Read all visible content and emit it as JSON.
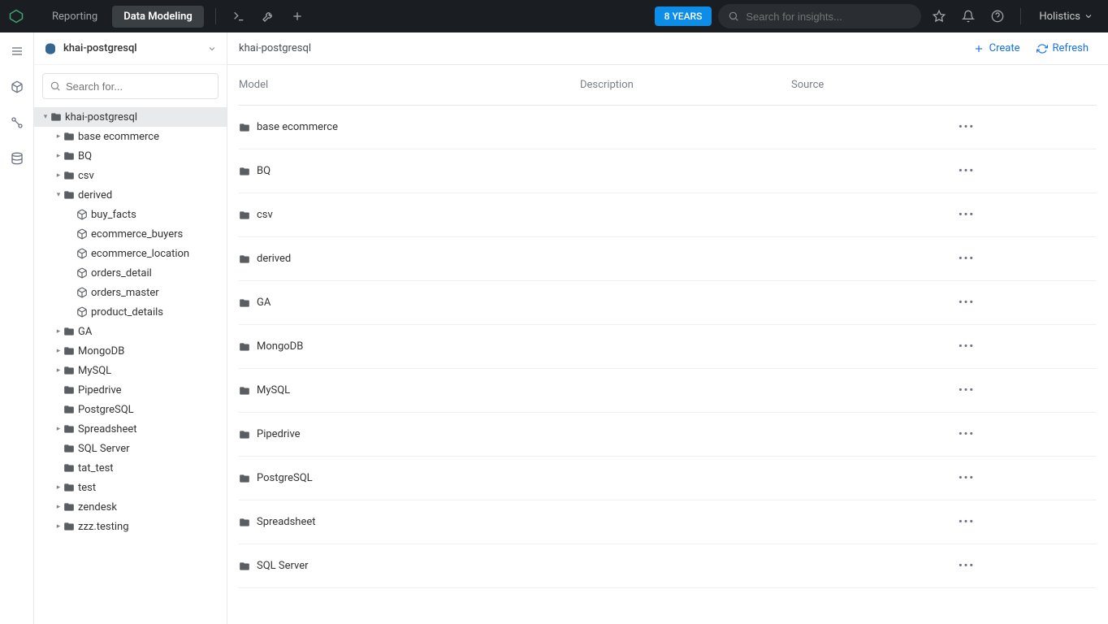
{
  "topbar": {
    "nav": {
      "reporting": "Reporting",
      "data_modeling": "Data Modeling"
    },
    "badge": "8 YEARS",
    "search_placeholder": "Search for insights...",
    "account_name": "Holistics"
  },
  "sidebar": {
    "source_name": "khai-postgresql",
    "search_placeholder": "Search for...",
    "tree": {
      "root": {
        "label": "khai-postgresql",
        "expanded": true
      },
      "folders": [
        {
          "label": "base ecommerce",
          "caret": true,
          "expanded": false
        },
        {
          "label": "BQ",
          "caret": true,
          "expanded": false
        },
        {
          "label": "csv",
          "caret": true,
          "expanded": false
        },
        {
          "label": "derived",
          "caret": true,
          "expanded": true,
          "children": [
            {
              "label": "buy_facts"
            },
            {
              "label": "ecommerce_buyers"
            },
            {
              "label": "ecommerce_location"
            },
            {
              "label": "orders_detail"
            },
            {
              "label": "orders_master"
            },
            {
              "label": "product_details"
            }
          ]
        },
        {
          "label": "GA",
          "caret": true,
          "expanded": false
        },
        {
          "label": "MongoDB",
          "caret": true,
          "expanded": false
        },
        {
          "label": "MySQL",
          "caret": true,
          "expanded": false
        },
        {
          "label": "Pipedrive",
          "caret": false
        },
        {
          "label": "PostgreSQL",
          "caret": false
        },
        {
          "label": "Spreadsheet",
          "caret": true,
          "expanded": false
        },
        {
          "label": "SQL Server",
          "caret": false
        },
        {
          "label": "tat_test",
          "caret": false
        },
        {
          "label": "test",
          "caret": true,
          "expanded": false
        },
        {
          "label": "zendesk",
          "caret": true,
          "expanded": false
        },
        {
          "label": "zzz.testing",
          "caret": true,
          "expanded": false
        }
      ]
    }
  },
  "content": {
    "breadcrumb": "khai-postgresql",
    "create_label": "Create",
    "refresh_label": "Refresh",
    "columns": {
      "model": "Model",
      "description": "Description",
      "source": "Source"
    },
    "rows": [
      {
        "name": "base ecommerce"
      },
      {
        "name": "BQ"
      },
      {
        "name": "csv"
      },
      {
        "name": "derived"
      },
      {
        "name": "GA"
      },
      {
        "name": "MongoDB"
      },
      {
        "name": "MySQL"
      },
      {
        "name": "Pipedrive"
      },
      {
        "name": "PostgreSQL"
      },
      {
        "name": "Spreadsheet"
      },
      {
        "name": "SQL Server"
      }
    ]
  }
}
